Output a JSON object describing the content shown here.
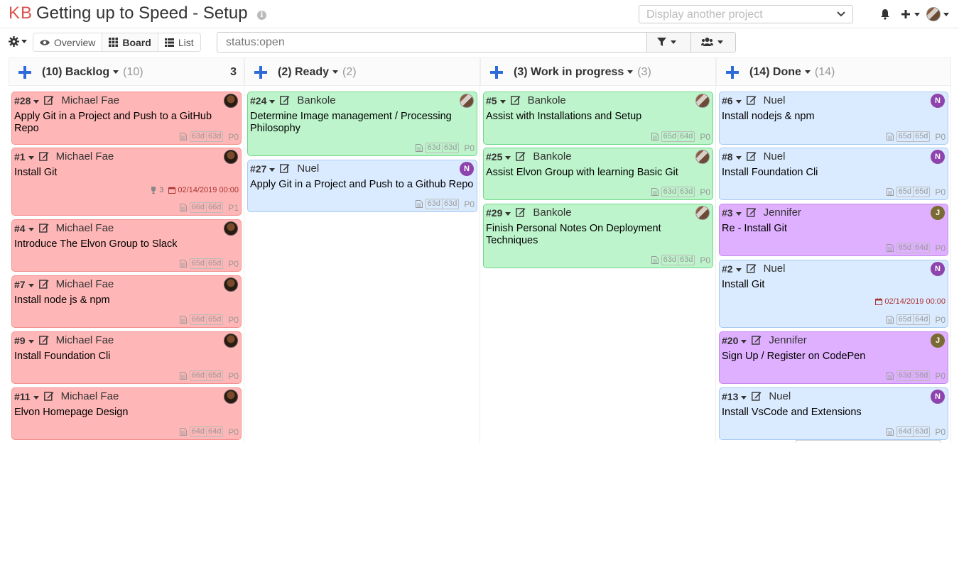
{
  "header": {
    "logo": "KB",
    "title": "Getting up to Speed - Setup",
    "project_select_placeholder": "Display another project"
  },
  "toolbar": {
    "views": [
      "Overview",
      "Board",
      "List"
    ],
    "active_view": "Board",
    "search_query": "status:open"
  },
  "columns": [
    {
      "name": "(10) Backlog",
      "count": "(10)",
      "limit": "3",
      "cards": [
        {
          "id": "#28",
          "owner": "Michael Fae",
          "title": "Apply Git in a Project and Push to a GitHub Repo",
          "ages": [
            "63d",
            "63d"
          ],
          "priority": "P0",
          "color": "red",
          "avatar": "photo"
        },
        {
          "id": "#1",
          "owner": "Michael Fae",
          "title": "Install Git",
          "score": "3",
          "due": "02/14/2019 00:00",
          "ages": [
            "66d",
            "66d"
          ],
          "priority": "P1",
          "color": "red",
          "avatar": "photo"
        },
        {
          "id": "#4",
          "owner": "Michael Fae",
          "title": "Introduce The Elvon Group to Slack",
          "ages": [
            "65d",
            "65d"
          ],
          "priority": "P0",
          "color": "red",
          "avatar": "photo"
        },
        {
          "id": "#7",
          "owner": "Michael Fae",
          "title": "Install node js & npm",
          "ages": [
            "66d",
            "65d"
          ],
          "priority": "P0",
          "color": "red",
          "avatar": "photo"
        },
        {
          "id": "#9",
          "owner": "Michael Fae",
          "title": "Install Foundation Cli",
          "ages": [
            "66d",
            "65d"
          ],
          "priority": "P0",
          "color": "red",
          "avatar": "photo"
        },
        {
          "id": "#11",
          "owner": "Michael Fae",
          "title": "Elvon Homepage Design",
          "ages": [
            "64d",
            "64d"
          ],
          "priority": "P0",
          "color": "red",
          "avatar": "photo"
        }
      ]
    },
    {
      "name": "(2) Ready",
      "count": "(2)",
      "limit": "",
      "cards": [
        {
          "id": "#24",
          "owner": "Bankole",
          "title": "Determine Image management / Processing Philosophy",
          "ages": [
            "63d",
            "63d"
          ],
          "priority": "P0",
          "color": "green",
          "avatar": "bank"
        },
        {
          "id": "#27",
          "owner": "Nuel",
          "title": "Apply Git in a Project and Push to a Github Repo",
          "ages": [
            "63d",
            "63d"
          ],
          "priority": "P0",
          "color": "blue",
          "avatar": "N"
        }
      ]
    },
    {
      "name": "(3) Work in progress",
      "count": "(3)",
      "limit": "",
      "cards": [
        {
          "id": "#5",
          "owner": "Bankole",
          "title": "Assist with Installations and Setup",
          "ages": [
            "65d",
            "64d"
          ],
          "priority": "P0",
          "color": "green",
          "avatar": "bank"
        },
        {
          "id": "#25",
          "owner": "Bankole",
          "title": "Assist Elvon Group with learning Basic Git",
          "ages": [
            "63d",
            "63d"
          ],
          "priority": "P0",
          "color": "green",
          "avatar": "bank"
        },
        {
          "id": "#29",
          "owner": "Bankole",
          "title": "Finish Personal Notes On Deployment Techniques",
          "ages": [
            "63d",
            "63d"
          ],
          "priority": "P0",
          "color": "green",
          "avatar": "bank"
        }
      ]
    },
    {
      "name": "(14) Done",
      "count": "(14)",
      "limit": "",
      "cards": [
        {
          "id": "#6",
          "owner": "Nuel",
          "title": "Install nodejs & npm",
          "ages": [
            "65d",
            "65d"
          ],
          "priority": "P0",
          "color": "blue",
          "avatar": "N"
        },
        {
          "id": "#8",
          "owner": "Nuel",
          "title": "Install Foundation Cli",
          "ages": [
            "65d",
            "65d"
          ],
          "priority": "P0",
          "color": "blue",
          "avatar": "N"
        },
        {
          "id": "#3",
          "owner": "Jennifer",
          "title": "Re - Install Git",
          "ages": [
            "65d",
            "64d"
          ],
          "priority": "P0",
          "color": "purple",
          "avatar": "J"
        },
        {
          "id": "#2",
          "owner": "Nuel",
          "title": "Install Git",
          "due": "02/14/2019 00:00",
          "ages": [
            "65d",
            "64d"
          ],
          "priority": "P0",
          "color": "blue",
          "avatar": "N"
        },
        {
          "id": "#20",
          "owner": "Jennifer",
          "title": "Sign Up / Register on CodePen",
          "ages": [
            "63d",
            "58d"
          ],
          "priority": "P0",
          "color": "purple",
          "avatar": "J"
        },
        {
          "id": "#13",
          "owner": "Nuel",
          "title": "Install VsCode and Extensions",
          "ages": [
            "64d",
            "63d"
          ],
          "priority": "P0",
          "color": "blue",
          "avatar": "N"
        }
      ]
    }
  ]
}
